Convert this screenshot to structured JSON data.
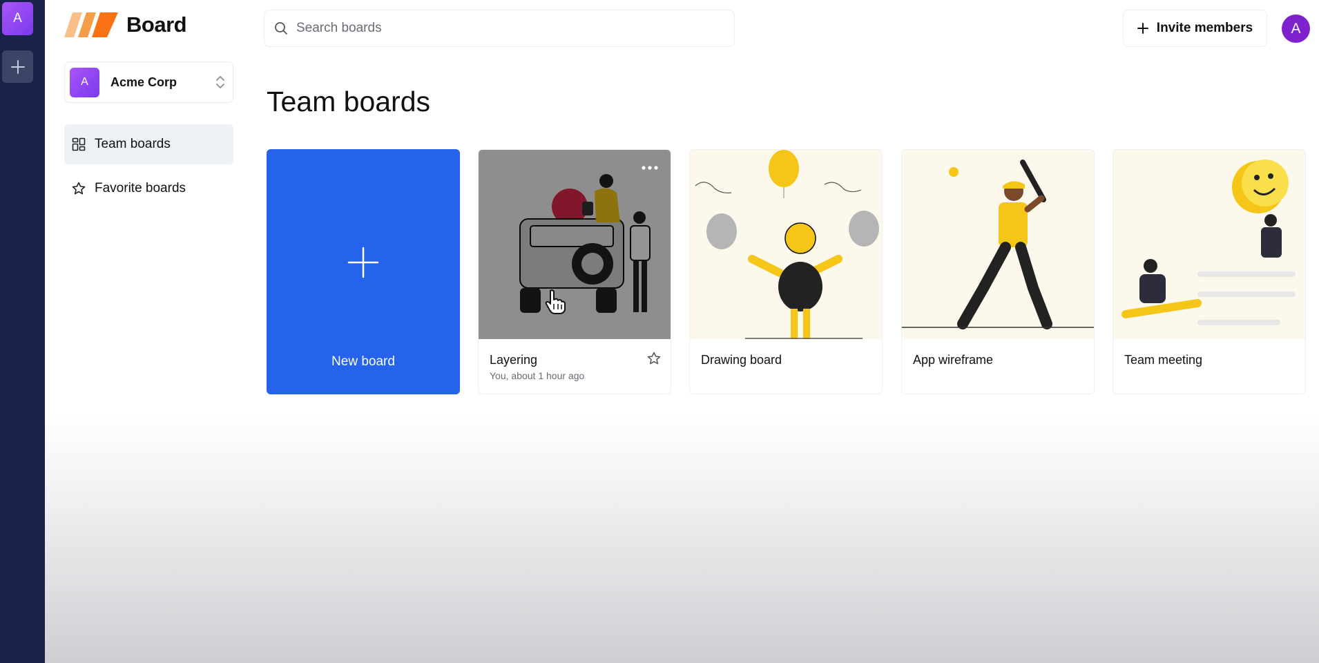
{
  "rail": {
    "org_initial": "A",
    "add_icon": "plus-icon",
    "color": "#18224a"
  },
  "brand": {
    "name": "Board",
    "logo_colors": [
      "#fbbf88",
      "#f59e4a",
      "#f97316"
    ]
  },
  "org_switcher": {
    "initial": "A",
    "name": "Acme Corp",
    "icon": "chevron-up-down-icon"
  },
  "sidebar": {
    "items": [
      {
        "label": "Team boards",
        "icon": "grid-icon",
        "active": true
      },
      {
        "label": "Favorite boards",
        "icon": "star-icon",
        "active": false
      }
    ]
  },
  "search": {
    "placeholder": "Search boards",
    "value": "",
    "icon": "search-icon"
  },
  "header": {
    "invite_label": "Invite members",
    "user_initial": "A",
    "user_color": "#7e22ce"
  },
  "main": {
    "title": "Team boards",
    "new_board_label": "New board",
    "accent": "#2563eb",
    "boards": [
      {
        "title": "Layering",
        "meta": "You, about 1 hour ago",
        "hovered": true
      },
      {
        "title": "Drawing board",
        "meta": "",
        "hovered": false
      },
      {
        "title": "App wireframe",
        "meta": "",
        "hovered": false
      },
      {
        "title": "Team meeting",
        "meta": "",
        "hovered": false
      }
    ]
  }
}
